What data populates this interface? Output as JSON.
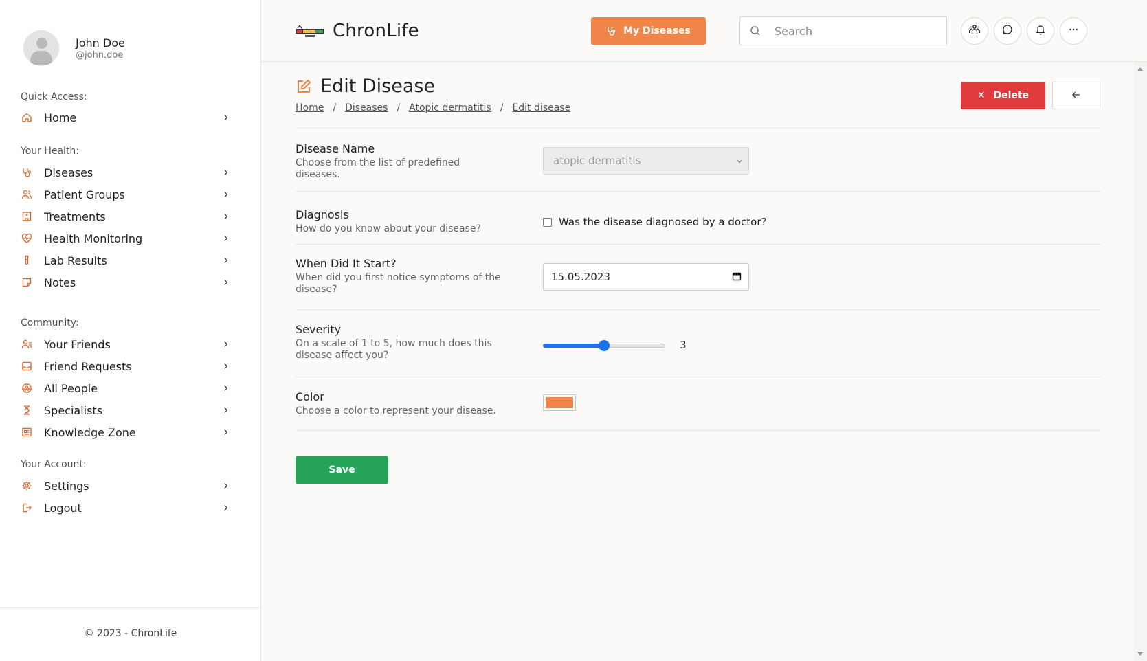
{
  "colors": {
    "accent": "#ef8548",
    "delete": "#e03a3c",
    "save": "#26a35a",
    "slider": "#1a73e8",
    "disease_color": "#ef8548"
  },
  "user": {
    "name": "John Doe",
    "handle": "@john.doe"
  },
  "sidebar": {
    "quick_access": {
      "title": "Quick Access:",
      "items": [
        {
          "label": "Home",
          "icon": "home-icon"
        }
      ]
    },
    "your_health": {
      "title": "Your Health:",
      "items": [
        {
          "label": "Diseases",
          "icon": "stethoscope-icon"
        },
        {
          "label": "Patient Groups",
          "icon": "patient-group-icon"
        },
        {
          "label": "Treatments",
          "icon": "hospital-icon"
        },
        {
          "label": "Health Monitoring",
          "icon": "heart-pulse-icon"
        },
        {
          "label": "Lab Results",
          "icon": "test-tube-icon"
        },
        {
          "label": "Notes",
          "icon": "note-icon"
        }
      ]
    },
    "community": {
      "title": "Community:",
      "items": [
        {
          "label": "Your Friends",
          "icon": "friends-icon"
        },
        {
          "label": "Friend Requests",
          "icon": "inbox-icon"
        },
        {
          "label": "All People",
          "icon": "people-icon"
        },
        {
          "label": "Specialists",
          "icon": "specialist-icon"
        },
        {
          "label": "Knowledge Zone",
          "icon": "book-icon"
        }
      ]
    },
    "your_account": {
      "title": "Your Account:",
      "items": [
        {
          "label": "Settings",
          "icon": "gear-icon"
        },
        {
          "label": "Logout",
          "icon": "logout-icon"
        }
      ]
    },
    "footer": "© 2023 - ChronLife"
  },
  "header": {
    "app_name": "ChronLife",
    "my_diseases_label": "My Diseases",
    "search_placeholder": "Search",
    "action_icons": [
      "community-icon",
      "chat-icon",
      "bell-icon",
      "more-icon"
    ]
  },
  "page": {
    "title": "Edit Disease",
    "breadcrumb": [
      "Home",
      "Diseases",
      "Atopic dermatitis",
      "Edit disease"
    ],
    "delete_label": "Delete",
    "save_label": "Save"
  },
  "form": {
    "disease_name": {
      "title": "Disease Name",
      "description": "Choose from the list of predefined diseases.",
      "value": "atopic dermatitis"
    },
    "diagnosis": {
      "title": "Diagnosis",
      "description": "How do you know about your disease?",
      "checkbox_label": "Was the disease diagnosed by a doctor?",
      "checked": false
    },
    "start": {
      "title": "When Did It Start?",
      "description": "When did you first notice symptoms of the disease?",
      "value": "15.05.2023"
    },
    "severity": {
      "title": "Severity",
      "description": "On a scale of 1 to 5, how much does this disease affect you?",
      "value": "3",
      "min": 1,
      "max": 5
    },
    "color": {
      "title": "Color",
      "description": "Choose a color to represent your disease.",
      "value": "#ef8548"
    }
  }
}
